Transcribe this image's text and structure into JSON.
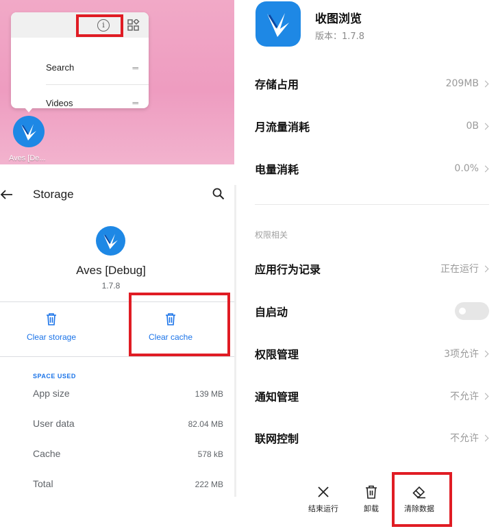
{
  "launcher": {
    "popup": {
      "items": [
        {
          "label": "Search"
        },
        {
          "label": "Videos"
        }
      ],
      "info_icon": "info-icon",
      "widgets_icon": "widgets-icon"
    },
    "app_label": "Aves [De..."
  },
  "storage": {
    "title": "Storage",
    "app_name": "Aves [Debug]",
    "app_version": "1.7.8",
    "actions": {
      "clear_storage": "Clear storage",
      "clear_cache": "Clear cache"
    },
    "space_used_header": "SPACE USED",
    "rows": [
      {
        "key": "App size",
        "value": "139 MB"
      },
      {
        "key": "User data",
        "value": "82.04 MB"
      },
      {
        "key": "Cache",
        "value": "578 kB"
      },
      {
        "key": "Total",
        "value": "222 MB"
      }
    ]
  },
  "appinfo": {
    "app_name": "收图浏览",
    "version": "版本：1.7.8",
    "rows": {
      "storage": {
        "label": "存储占用",
        "value": "209MB"
      },
      "data": {
        "label": "月流量消耗",
        "value": "0B"
      },
      "battery": {
        "label": "电量消耗",
        "value": "0.0%"
      },
      "behavior": {
        "label": "应用行为记录",
        "value": "正在运行"
      },
      "autostart": {
        "label": "自启动",
        "enabled": false
      },
      "permissions": {
        "label": "权限管理",
        "value": "3项允许"
      },
      "notifications": {
        "label": "通知管理",
        "value": "不允许"
      },
      "network": {
        "label": "联网控制",
        "value": "不允许"
      }
    },
    "section_permissions": "权限相关",
    "bottom_actions": {
      "force_stop": "结束运行",
      "uninstall": "卸载",
      "clear_data": "清除数据"
    }
  },
  "colors": {
    "highlight": "#e01c24",
    "accent_blue": "#1a73e8",
    "app_icon_bg": "#1e88e5",
    "launcher_bg": "#ee9cc0"
  }
}
